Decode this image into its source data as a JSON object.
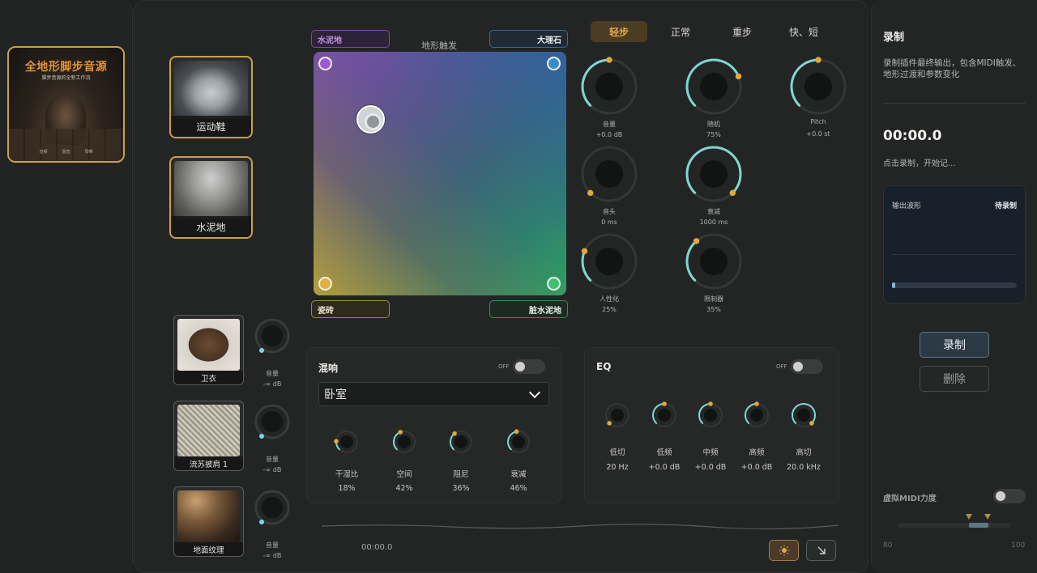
{
  "preset": {
    "title": "全地形脚步音源",
    "subtitle": "脚步音源的全新工作流",
    "footer": [
      "音频",
      "混音",
      "母带"
    ]
  },
  "materials": [
    {
      "label": "运动鞋"
    },
    {
      "label": "水泥地"
    }
  ],
  "layers": [
    {
      "label": "卫衣",
      "vol_label": "音量",
      "vol_value": "-∞ dB"
    },
    {
      "label": "流苏披肩 1",
      "vol_label": "音量",
      "vol_value": "-∞ dB"
    },
    {
      "label": "地面纹理",
      "vol_label": "音量",
      "vol_value": "-∞ dB"
    }
  ],
  "pad": {
    "title": "地形触发",
    "corners": {
      "top_left": "水泥地",
      "top_right": "大理石",
      "bottom_left": "瓷砖",
      "bottom_right": "脏水泥地"
    }
  },
  "tabs": [
    "轻步",
    "正常",
    "重步",
    "快、短"
  ],
  "active_tab": "轻步",
  "knobs": [
    {
      "label": "音量",
      "value": "+0.0 dB",
      "level": 0.5
    },
    {
      "label": "随机",
      "value": "75%",
      "level": 0.75
    },
    {
      "label": "Pitch",
      "value": "+0.0 st",
      "level": 0.5
    },
    {
      "label": "音头",
      "value": "0 ms",
      "level": 0.0
    },
    {
      "label": "衰减",
      "value": "1000 ms",
      "level": 1.0
    },
    {
      "label": "人性化",
      "value": "25%",
      "level": 0.25
    },
    {
      "label": "限制器",
      "value": "35%",
      "level": 0.35
    }
  ],
  "reverb": {
    "title": "混响",
    "toggle": "OFF",
    "room": "卧室",
    "params": [
      {
        "label": "干湿比",
        "value": "18%",
        "level": 0.18
      },
      {
        "label": "空间",
        "value": "42%",
        "level": 0.42
      },
      {
        "label": "阻尼",
        "value": "36%",
        "level": 0.36
      },
      {
        "label": "衰减",
        "value": "46%",
        "level": 0.46
      }
    ]
  },
  "eq": {
    "title": "EQ",
    "toggle": "OFF",
    "bands": [
      {
        "label": "低切",
        "value": "20 Hz",
        "level": 0.0
      },
      {
        "label": "低频",
        "value": "+0.0 dB",
        "level": 0.5
      },
      {
        "label": "中频",
        "value": "+0.0 dB",
        "level": 0.5
      },
      {
        "label": "高频",
        "value": "+0.0 dB",
        "level": 0.5
      },
      {
        "label": "高切",
        "value": "20.0 kHz",
        "level": 1.0
      }
    ]
  },
  "transport": {
    "time": "00:00.0"
  },
  "recorder": {
    "title": "录制",
    "description": "录制插件最终输出，包含MIDI触发、地形过渡和参数变化",
    "time": "00:00.0",
    "hint": "点击录制，开始记...",
    "wave_title": "输出波形",
    "wave_status": "待录制",
    "record_label": "录制",
    "delete_label": "删除"
  },
  "velocity": {
    "title": "虚拟MIDI力度",
    "min": "80",
    "max": "100"
  },
  "colors": {
    "accent_gold": "#c9a04a",
    "knob_teal": "#7fd6d0",
    "knob_dot": "#e0a840"
  }
}
